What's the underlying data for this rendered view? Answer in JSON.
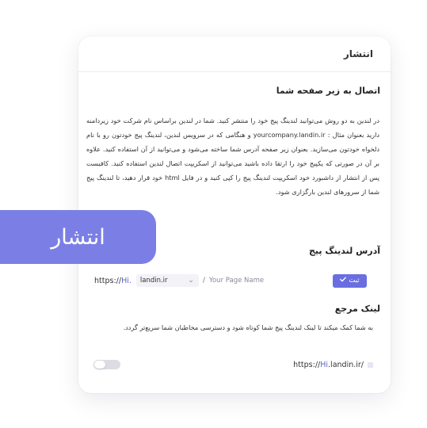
{
  "header": {
    "title": "انتشار"
  },
  "subdomain_section": {
    "title": "اتصال به زیر صفحه شما",
    "description": "در لندین به دو روش می‌توانید لندینگ پیج خود را منتشر کنید. شما در لندین براساس نام شرکت خود زیردامنه دارید بعنوان مثال : yourcompany.landin.ir و هنگامی که در سرویس لندین، لندینگ پیج خودتون رو با نام دلخواه خودتون می‌سازید. بعنوان زیر صفحه آدرس شما ساخته می‌شود و می‌توانید از آن استفاده کنید. علاوه بر آن در صورتی که یکپیج خود را ارتقا داده باشید می‌توانید از اسکریپت اتصال لندین استفاده کنید. کافیست پس از انتشار از داشبورد خود اسکریپت لندینگ پیج را کپی کنید و در فایل html خود قرار دهید، تا لندینگ پیج شما از سرورهای لندین بارگزاری شود."
  },
  "address_section": {
    "title": "آدرس لندینگ پیج",
    "prefix_plain": "https://",
    "prefix_highlight": "Hi.",
    "domain_selected": "landin.ir",
    "slash": "/",
    "page_name_placeholder": "Your Page Name",
    "submit_label": "ثبت"
  },
  "reference_section": {
    "title": "لینک مرجع",
    "description": "به شما کمک میکند تا لینک لندینگ پیج شما کوتاه شود و دسترسی مخاطبان شما سریع‌تر گردد.",
    "url_plain_start": "https://",
    "url_highlight": "Hi",
    "url_plain_end": ".landin.ir/",
    "toggle_on": false
  },
  "badge": {
    "label": "انتشار"
  },
  "colors": {
    "accent": "#6a6ee0",
    "badge": "#7b7fe5"
  },
  "icons": {
    "select_chevron": "chevron-down-icon",
    "submit_check": "check-icon"
  }
}
